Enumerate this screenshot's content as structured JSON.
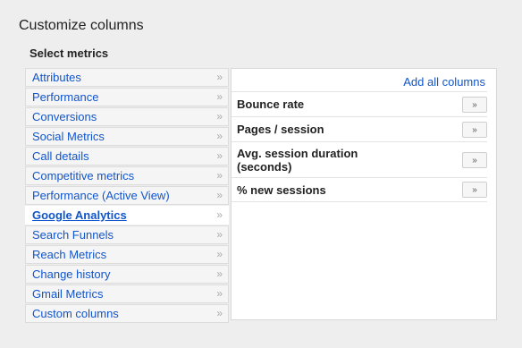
{
  "dialog": {
    "title": "Customize columns",
    "subtitle": "Select metrics"
  },
  "categories": [
    {
      "label": "Attributes",
      "chevron": "»",
      "selected": false
    },
    {
      "label": "Performance",
      "chevron": "»",
      "selected": false
    },
    {
      "label": "Conversions",
      "chevron": "»",
      "selected": false
    },
    {
      "label": "Social Metrics",
      "chevron": "»",
      "selected": false
    },
    {
      "label": "Call details",
      "chevron": "»",
      "selected": false
    },
    {
      "label": "Competitive metrics",
      "chevron": "»",
      "selected": false
    },
    {
      "label": "Performance (Active View)",
      "chevron": "»",
      "selected": false
    },
    {
      "label": "Google Analytics",
      "chevron": "»",
      "selected": true
    },
    {
      "label": "Search Funnels",
      "chevron": "»",
      "selected": false
    },
    {
      "label": "Reach Metrics",
      "chevron": "»",
      "selected": false
    },
    {
      "label": "Change history",
      "chevron": "»",
      "selected": false
    },
    {
      "label": "Gmail Metrics",
      "chevron": "»",
      "selected": false
    },
    {
      "label": "Custom columns",
      "chevron": "»",
      "selected": false
    }
  ],
  "panel": {
    "add_all_label": "Add all columns",
    "metrics": [
      {
        "label": "Bounce rate",
        "button": "»"
      },
      {
        "label": "Pages / session",
        "button": "»"
      },
      {
        "label": "Avg. session duration (seconds)",
        "button": "»"
      },
      {
        "label": "% new sessions",
        "button": "»"
      }
    ]
  },
  "colors": {
    "link": "#1155cc",
    "background": "#eeeeee",
    "panel": "#ffffff"
  }
}
